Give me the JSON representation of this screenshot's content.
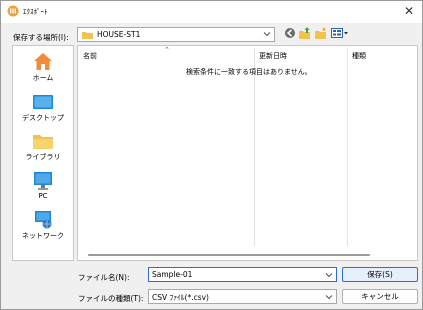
{
  "window": {
    "title": "ｴｸｽﾎﾟｰﾄ",
    "close_symbol": "✕"
  },
  "location": {
    "label": "保存する場所(I):",
    "value": "HOUSE-ST1"
  },
  "toolbar_icons": [
    "back-icon",
    "up-folder-icon",
    "new-folder-icon",
    "view-menu-icon"
  ],
  "places": [
    {
      "label": "ホーム",
      "icon": "home-icon"
    },
    {
      "label": "デスクトップ",
      "icon": "desktop-icon"
    },
    {
      "label": "ライブラリ",
      "icon": "library-icon"
    },
    {
      "label": "PC",
      "icon": "pc-icon"
    },
    {
      "label": "ネットワーク",
      "icon": "network-icon"
    }
  ],
  "file_list": {
    "columns": [
      "名前",
      "更新日時",
      "種類"
    ],
    "empty_message": "検索条件に一致する項目はありません。"
  },
  "filename": {
    "label": "ファイル名(N):",
    "value": "Sample-01"
  },
  "filetype": {
    "label": "ファイルの種類(T):",
    "value": "CSV ﾌｧｲﾙ(*.csv)"
  },
  "buttons": {
    "save": "保存(S)",
    "cancel": "キャンセル"
  },
  "colors": {
    "accent": "#2b6fd6",
    "folder": "#f2c14e",
    "window_bg": "#f0f0f0"
  }
}
